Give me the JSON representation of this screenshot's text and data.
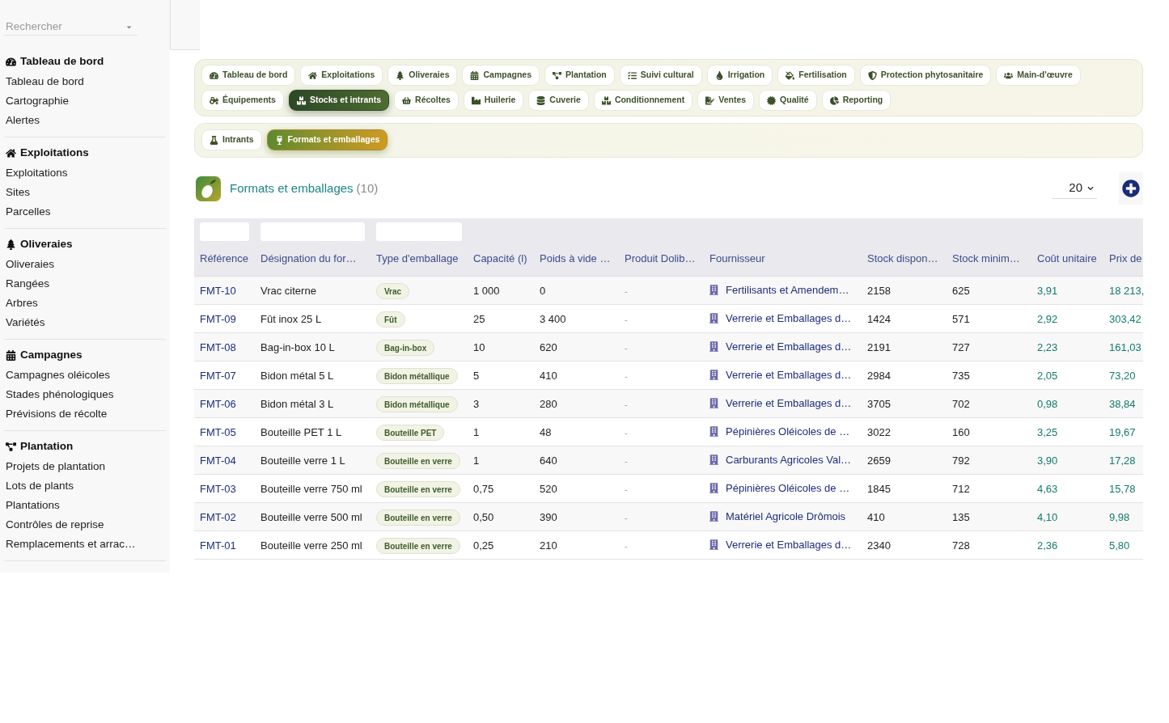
{
  "sidebar": {
    "search": {
      "placeholder": "Rechercher"
    },
    "sections": [
      {
        "title": "Tableau de bord",
        "items": [
          "Tableau de bord",
          "Cartographie",
          "Alertes"
        ]
      },
      {
        "title": "Exploitations",
        "items": [
          "Exploitations",
          "Sites",
          "Parcelles"
        ]
      },
      {
        "title": "Oliveraies",
        "items": [
          "Oliveraies",
          "Rangées",
          "Arbres",
          "Variétés"
        ]
      },
      {
        "title": "Campagnes",
        "items": [
          "Campagnes oléicoles",
          "Stades phénologiques",
          "Prévisions de récolte"
        ]
      },
      {
        "title": "Plantation",
        "items": [
          "Projets de plantation",
          "Lots de plants",
          "Plantations",
          "Contrôles de reprise",
          "Remplacements et arrac…"
        ]
      }
    ]
  },
  "module_tabs": [
    {
      "label": "Tableau de bord",
      "selected": false
    },
    {
      "label": "Exploitations",
      "selected": false
    },
    {
      "label": "Oliveraies",
      "selected": false
    },
    {
      "label": "Campagnes",
      "selected": false
    },
    {
      "label": "Plantation",
      "selected": false
    },
    {
      "label": "Suivi cultural",
      "selected": false
    },
    {
      "label": "Irrigation",
      "selected": false
    },
    {
      "label": "Fertilisation",
      "selected": false
    },
    {
      "label": "Protection phytosanitaire",
      "selected": false
    },
    {
      "label": "Main-d'œuvre",
      "selected": false
    },
    {
      "label": "Équipements",
      "selected": false
    },
    {
      "label": "Stocks et intrants",
      "selected": true
    },
    {
      "label": "Récoltes",
      "selected": false
    },
    {
      "label": "Huilerie",
      "selected": false
    },
    {
      "label": "Cuverie",
      "selected": false
    },
    {
      "label": "Conditionnement",
      "selected": false
    },
    {
      "label": "Ventes",
      "selected": false
    },
    {
      "label": "Qualité",
      "selected": false
    },
    {
      "label": "Reporting",
      "selected": false
    }
  ],
  "sub_tabs": [
    {
      "label": "Intrants",
      "selected": false
    },
    {
      "label": "Formats et emballages",
      "selected": true
    }
  ],
  "list_header": {
    "title": "Formats et emballages",
    "count": "(10)",
    "page_size": "20"
  },
  "table": {
    "columns": [
      {
        "label": "Référence",
        "filter": true
      },
      {
        "label": "Désignation du for…",
        "filter": true
      },
      {
        "label": "Type d'emballage",
        "filter": true
      },
      {
        "label": "Capacité (l)",
        "filter": false
      },
      {
        "label": "Poids à vide …",
        "filter": false
      },
      {
        "label": "Produit Dolib…",
        "filter": false
      },
      {
        "label": "Fournisseur",
        "filter": false
      },
      {
        "label": "Stock dispon…",
        "filter": false
      },
      {
        "label": "Stock minim…",
        "filter": false
      },
      {
        "label": "Coût unitaire",
        "filter": false
      },
      {
        "label": "Prix de",
        "filter": false
      }
    ],
    "rows": [
      {
        "reference": "FMT-10",
        "designation": "Vrac citerne",
        "packaging_type": "Vrac",
        "capacity": "1 000",
        "empty_weight": "0",
        "dolibarr_product": "-",
        "supplier": "Fertilisants et Amendem…",
        "stock_available": "2158",
        "stock_minimum": "625",
        "unit_cost": "3,91",
        "price": "18 213,"
      },
      {
        "reference": "FMT-09",
        "designation": "Fût inox 25 L",
        "packaging_type": "Fût",
        "capacity": "25",
        "empty_weight": "3 400",
        "dolibarr_product": "-",
        "supplier": "Verrerie et Emballages d…",
        "stock_available": "1424",
        "stock_minimum": "571",
        "unit_cost": "2,92",
        "price": "303,42"
      },
      {
        "reference": "FMT-08",
        "designation": "Bag-in-box 10 L",
        "packaging_type": "Bag-in-box",
        "capacity": "10",
        "empty_weight": "620",
        "dolibarr_product": "-",
        "supplier": "Verrerie et Emballages d…",
        "stock_available": "2191",
        "stock_minimum": "727",
        "unit_cost": "2,23",
        "price": "161,03"
      },
      {
        "reference": "FMT-07",
        "designation": "Bidon métal 5 L",
        "packaging_type": "Bidon métallique",
        "capacity": "5",
        "empty_weight": "410",
        "dolibarr_product": "-",
        "supplier": "Verrerie et Emballages d…",
        "stock_available": "2984",
        "stock_minimum": "735",
        "unit_cost": "2,05",
        "price": "73,20"
      },
      {
        "reference": "FMT-06",
        "designation": "Bidon métal 3 L",
        "packaging_type": "Bidon métallique",
        "capacity": "3",
        "empty_weight": "280",
        "dolibarr_product": "-",
        "supplier": "Verrerie et Emballages d…",
        "stock_available": "3705",
        "stock_minimum": "702",
        "unit_cost": "0,98",
        "price": "38,84"
      },
      {
        "reference": "FMT-05",
        "designation": "Bouteille PET 1 L",
        "packaging_type": "Bouteille PET",
        "capacity": "1",
        "empty_weight": "48",
        "dolibarr_product": "-",
        "supplier": "Pépinières Oléicoles de …",
        "stock_available": "3022",
        "stock_minimum": "160",
        "unit_cost": "3,25",
        "price": "19,67"
      },
      {
        "reference": "FMT-04",
        "designation": "Bouteille verre 1 L",
        "packaging_type": "Bouteille en verre",
        "capacity": "1",
        "empty_weight": "640",
        "dolibarr_product": "-",
        "supplier": "Carburants Agricoles Val…",
        "stock_available": "2659",
        "stock_minimum": "792",
        "unit_cost": "3,90",
        "price": "17,28"
      },
      {
        "reference": "FMT-03",
        "designation": "Bouteille verre 750 ml",
        "packaging_type": "Bouteille en verre",
        "capacity": "0,75",
        "empty_weight": "520",
        "dolibarr_product": "-",
        "supplier": "Pépinières Oléicoles de …",
        "stock_available": "1845",
        "stock_minimum": "712",
        "unit_cost": "4,63",
        "price": "15,78"
      },
      {
        "reference": "FMT-02",
        "designation": "Bouteille verre 500 ml",
        "packaging_type": "Bouteille en verre",
        "capacity": "0,50",
        "empty_weight": "390",
        "dolibarr_product": "-",
        "supplier": "Matériel Agricole Drômois",
        "stock_available": "410",
        "stock_minimum": "135",
        "unit_cost": "4,10",
        "price": "9,98"
      },
      {
        "reference": "FMT-01",
        "designation": "Bouteille verre 250 ml",
        "packaging_type": "Bouteille en verre",
        "capacity": "0,25",
        "empty_weight": "210",
        "dolibarr_product": "-",
        "supplier": "Verrerie et Emballages d…",
        "stock_available": "2340",
        "stock_minimum": "728",
        "unit_cost": "2,36",
        "price": "5,80"
      }
    ]
  }
}
